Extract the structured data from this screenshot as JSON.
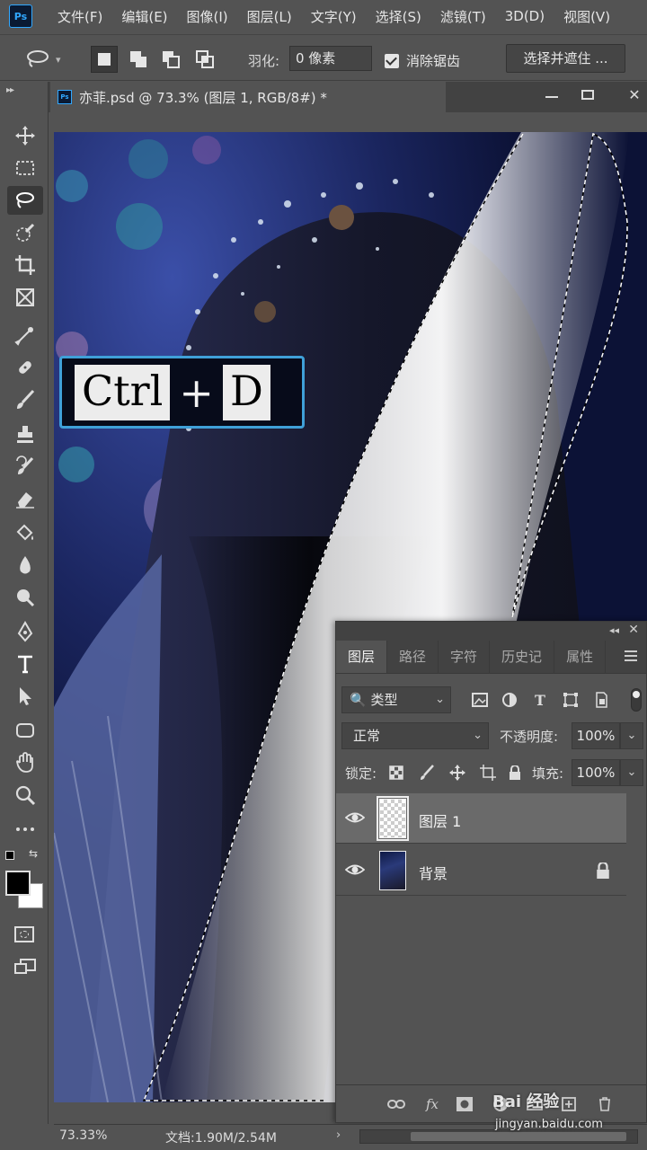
{
  "app": {
    "logo_text": "Ps"
  },
  "menubar": {
    "items": [
      "文件(F)",
      "编辑(E)",
      "图像(I)",
      "图层(L)",
      "文字(Y)",
      "选择(S)",
      "滤镜(T)",
      "3D(D)",
      "视图(V)"
    ]
  },
  "options": {
    "feather_label": "羽化:",
    "feather_value": "0 像素",
    "antialias_label": "消除锯齿",
    "antialias_checked": true,
    "select_mask_label": "选择并遮住 ..."
  },
  "document": {
    "tab_title": "亦菲.psd @ 73.3% (图层 1, RGB/8#) *",
    "tab_icon_text": "Ps"
  },
  "toolbox": {
    "collapse_glyph": "▸▸",
    "tools": [
      "move-tool",
      "marquee-tool",
      "lasso-tool",
      "quick-selection-tool",
      "crop-tool",
      "frame-tool",
      "eyedropper-tool",
      "healing-brush-tool",
      "brush-tool",
      "clone-stamp-tool",
      "history-brush-tool",
      "eraser-tool",
      "paint-bucket-tool",
      "blur-tool",
      "dodge-tool",
      "pen-tool",
      "type-tool",
      "path-selection-tool",
      "shape-tool",
      "hand-tool",
      "zoom-tool",
      "more-tools"
    ],
    "active_tool": "lasso-tool",
    "foreground_color": "#000000",
    "background_color": "#ffffff"
  },
  "overlay": {
    "key_ctrl": "Ctrl",
    "plus": "+",
    "key_d": "D"
  },
  "layers_panel": {
    "collapse_glyph": "◂◂",
    "close_glyph": "✕",
    "tabs": [
      "图层",
      "路径",
      "字符",
      "历史记",
      "属性"
    ],
    "active_tab": "图层",
    "filter_label": "🔍 类型",
    "blend_mode": "正常",
    "opacity_label": "不透明度:",
    "opacity_value": "100%",
    "lock_label": "锁定:",
    "fill_label": "填充:",
    "fill_value": "100%",
    "layers": [
      {
        "name": "图层 1",
        "selected": true,
        "visible": true,
        "locked": false
      },
      {
        "name": "背景",
        "selected": false,
        "visible": true,
        "locked": true
      }
    ]
  },
  "statusbar": {
    "zoom": "73.33%",
    "doc_info": "文档:1.90M/2.54M",
    "arrow": "›"
  },
  "watermark": {
    "brand": "Bai 经验",
    "url": "jingyan.baidu.com"
  }
}
